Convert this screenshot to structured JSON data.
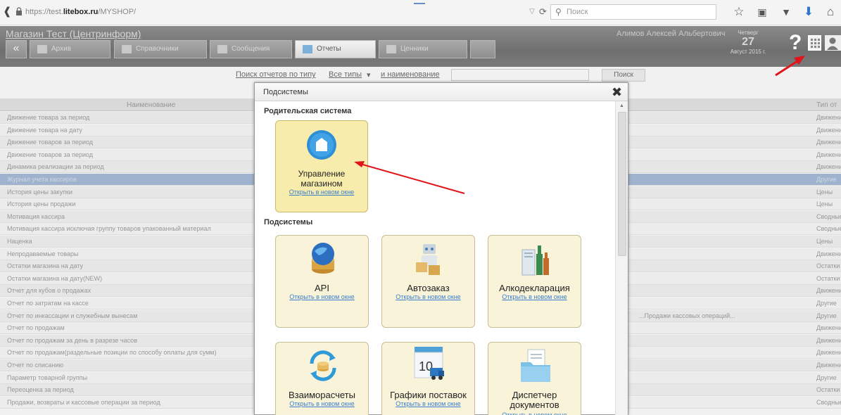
{
  "browser": {
    "url_prefix": "https://test.",
    "url_domain": "litebox.ru",
    "url_path": "/MYSHOP/",
    "search_placeholder": "Поиск"
  },
  "header": {
    "shop_title": "Магазин Тест (Центринформ)",
    "user_name": "Алимов Алексей Альбертович",
    "date_dow": "Четверг",
    "date_day": "27",
    "date_month": "Август 2015 г.",
    "help": "?"
  },
  "tabs": [
    "Архив",
    "Справочники",
    "Сообщения",
    "Отчеты",
    "Ценники"
  ],
  "filter": {
    "prefix": "Поиск отчетов по типу",
    "type": "Все типы",
    "name_label": "и наименование",
    "button": "Поиск"
  },
  "table": {
    "col_name": "Наименование",
    "col_type": "Тип от",
    "rows": [
      {
        "name": "Движение товара за период",
        "type": "Движение"
      },
      {
        "name": "Движение товара на дату",
        "type": "Движение"
      },
      {
        "name": "Движение товаров за период",
        "type": "Движение"
      },
      {
        "name": "Движение товаров за период",
        "type": "Движение"
      },
      {
        "name": "Динамика реализации за период",
        "type": "Движение"
      },
      {
        "name": "Журнал учета кассиров",
        "type": "Другие"
      },
      {
        "name": "История цены закупки",
        "type": "Цены"
      },
      {
        "name": "История цены продажи",
        "type": "Цены"
      },
      {
        "name": "Мотивация кассира",
        "type": "Сводные"
      },
      {
        "name": "Мотивация кассира исключая группу товаров упакованный материал",
        "type": "Сводные"
      },
      {
        "name": "Наценка",
        "type": "Цены"
      },
      {
        "name": "Непродаваемые товары",
        "type": "Движение"
      },
      {
        "name": "Остатки магазина на дату",
        "type": "Остатки"
      },
      {
        "name": "Остатки магазина на дату(NEW)",
        "type": "Остатки"
      },
      {
        "name": "Отчет для кубов о продажах",
        "type": "Движение"
      },
      {
        "name": "Отчет по затратам на кассе",
        "type": "Другие"
      },
      {
        "name": "Отчет по инкассации и служебным вынесам",
        "type": "Другие",
        "extra": "...Продажи кассовых операций..."
      },
      {
        "name": "Отчет по продажам",
        "type": "Движение"
      },
      {
        "name": "Отчет по продажам за день в разрезе часов",
        "type": "Движение"
      },
      {
        "name": "Отчет по продажам(раздельные позиции по способу оплаты для сумм)",
        "type": "Движение"
      },
      {
        "name": "Отчет по списанию",
        "type": "Движение"
      },
      {
        "name": "Параметр товарной группы",
        "type": "Другие"
      },
      {
        "name": "Переоценка за период",
        "type": "Остатки"
      },
      {
        "name": "Продажи, возвраты и кассовые операции за период",
        "type": "Сводные"
      }
    ]
  },
  "modal": {
    "title": "Подсистемы",
    "close": "✖",
    "parent_section": "Родительская система",
    "sub_section": "Подсистемы",
    "open_link": "Открыть в новом окне",
    "parent_tile": {
      "label": "Управление магазином",
      "icon": "store-icon"
    },
    "tiles": [
      {
        "label": "API",
        "icon": "globe-database-icon"
      },
      {
        "label": "Автозаказ",
        "icon": "robot-boxes-icon"
      },
      {
        "label": "Алкодекларация",
        "icon": "bottles-icon"
      },
      {
        "label": "Взаиморасчеты",
        "icon": "coins-arrows-icon"
      },
      {
        "label": "Графики поставок",
        "icon": "calendar-truck-icon"
      },
      {
        "label": "Диспетчер документов",
        "icon": "folder-documents-icon"
      }
    ]
  },
  "colors": {
    "accent": "#3a7fcf",
    "tile_bg": "#f8f3d9",
    "parent_tile_bg": "#f8ecac",
    "annotation_arrow": "#e0151b"
  }
}
